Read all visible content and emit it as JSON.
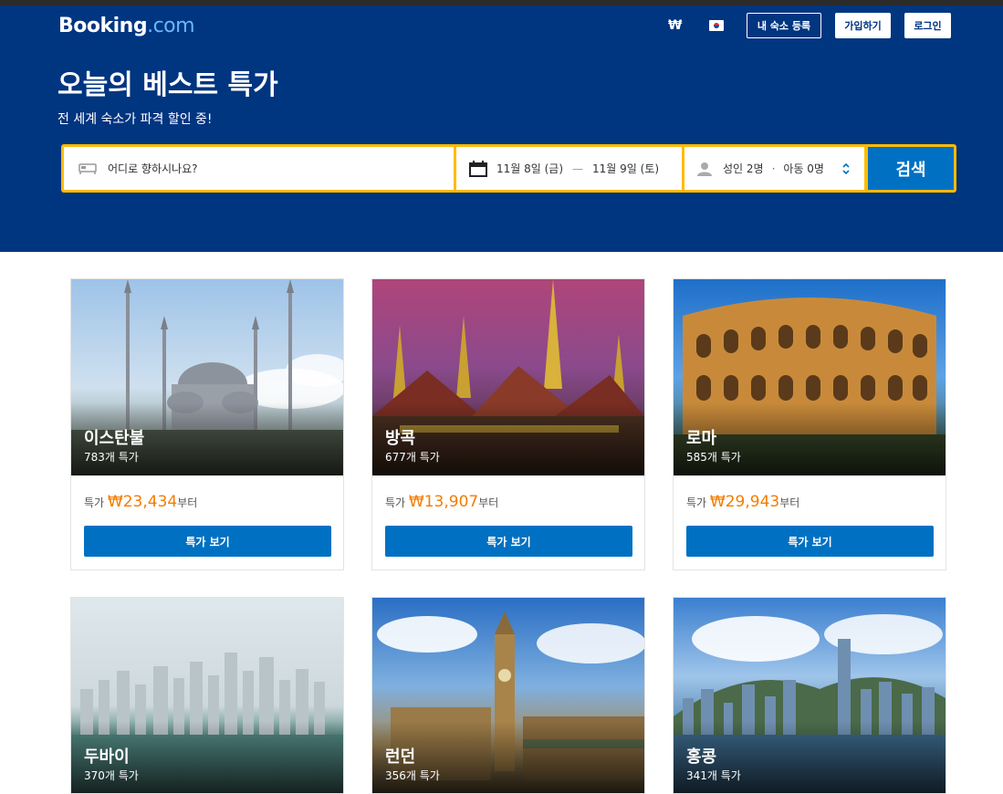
{
  "header": {
    "logo_main": "Booking",
    "logo_suffix": ".com",
    "currency": "₩",
    "language_icon": "kr-flag-icon",
    "list_property": "내 숙소 등록",
    "register": "가입하기",
    "login": "로그인"
  },
  "hero": {
    "title": "오늘의 베스트 특가",
    "subtitle": "전 세계 숙소가 파격 할인 중!"
  },
  "search": {
    "destination_placeholder": "어디로 향하시나요?",
    "checkin": "11월 8일 (금)",
    "date_separator": "—",
    "checkout": "11월 9일 (토)",
    "adults": "성인 2명",
    "guest_separator": "·",
    "children": "아동 0명",
    "button": "검색"
  },
  "deals": [
    {
      "city": "이스탄불",
      "count": "783개 특가",
      "price_prefix": "특가 ",
      "price": "₩23,434",
      "price_suffix": "부터",
      "button": "특가 보기"
    },
    {
      "city": "방콕",
      "count": "677개 특가",
      "price_prefix": "특가 ",
      "price": "₩13,907",
      "price_suffix": "부터",
      "button": "특가 보기"
    },
    {
      "city": "로마",
      "count": "585개 특가",
      "price_prefix": "특가 ",
      "price": "₩29,943",
      "price_suffix": "부터",
      "button": "특가 보기"
    },
    {
      "city": "두바이",
      "count": "370개 특가"
    },
    {
      "city": "런던",
      "count": "356개 특가"
    },
    {
      "city": "홍콩",
      "count": "341개 특가"
    }
  ],
  "colors": {
    "brand_blue": "#003580",
    "action_blue": "#0071c2",
    "search_border": "#febb02",
    "price_orange": "#f57c00"
  }
}
